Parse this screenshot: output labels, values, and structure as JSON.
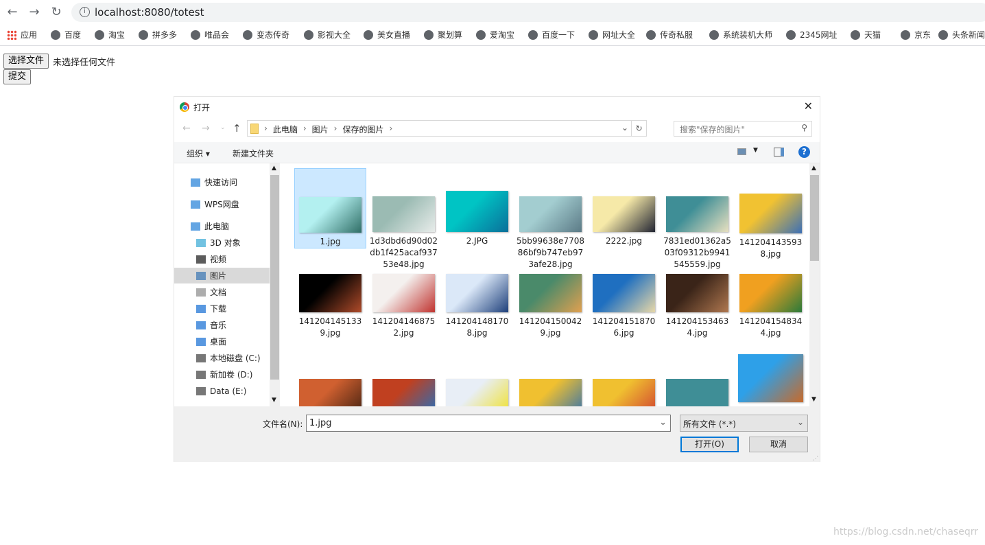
{
  "browser": {
    "url": "localhost:8080/totest",
    "bookmarks": [
      "应用",
      "百度",
      "淘宝",
      "拼多多",
      "唯品会",
      "变态传奇",
      "影视大全",
      "美女直播",
      "聚划算",
      "爱淘宝",
      "百度一下",
      "网址大全",
      "传奇私服",
      "系统装机大师",
      "2345网址",
      "天猫",
      "京东",
      "头条新闻"
    ]
  },
  "page": {
    "choose_file": "选择文件",
    "no_file": "未选择任何文件",
    "submit": "提交"
  },
  "dialog": {
    "title": "打开",
    "breadcrumb": [
      "此电脑",
      "图片",
      "保存的图片"
    ],
    "search_placeholder": "搜索\"保存的图片\"",
    "organize": "组织 ▾",
    "new_folder": "新建文件夹",
    "nav": [
      {
        "label": "快速访问",
        "icon": "star-icon"
      },
      {
        "label": "WPS网盘",
        "icon": "cloud-icon"
      },
      {
        "label": "此电脑",
        "icon": "computer-icon"
      },
      {
        "label": "3D 对象",
        "icon": "cube-icon"
      },
      {
        "label": "视频",
        "icon": "video-icon"
      },
      {
        "label": "图片",
        "icon": "picture-icon",
        "selected": true
      },
      {
        "label": "文档",
        "icon": "document-icon"
      },
      {
        "label": "下载",
        "icon": "download-icon"
      },
      {
        "label": "音乐",
        "icon": "music-icon"
      },
      {
        "label": "桌面",
        "icon": "desktop-icon"
      },
      {
        "label": "本地磁盘 (C:)",
        "icon": "drive-icon"
      },
      {
        "label": "新加卷 (D:)",
        "icon": "drive-icon"
      },
      {
        "label": "Data (E:)",
        "icon": "drive-icon"
      }
    ],
    "files": [
      {
        "name": "1.jpg",
        "colors": [
          "#b3f0f0",
          "#2f6e66"
        ],
        "selected": true
      },
      {
        "name": "1d3dbd6d90d02db1f425acaf93753e48.jpg",
        "colors": [
          "#9bbbb3",
          "#e8ecea"
        ]
      },
      {
        "name": "2.JPG",
        "colors": [
          "#00c4c4",
          "#0a6f9a"
        ]
      },
      {
        "name": "5bb99638e770886bf9b747eb973afe28.jpg",
        "colors": [
          "#a3cdd0",
          "#5b7a86"
        ]
      },
      {
        "name": "2222.jpg",
        "colors": [
          "#f6e9a8",
          "#222533"
        ]
      },
      {
        "name": "7831ed01362a503f09312b9941545559.jpg",
        "colors": [
          "#3f8e96",
          "#e8e0c0"
        ]
      },
      {
        "name": "1412041435938.jpg",
        "colors": [
          "#f1c232",
          "#3b6fb6"
        ]
      },
      {
        "name": "1412041451339.jpg",
        "colors": [
          "#000000",
          "#b04b2a"
        ]
      },
      {
        "name": "1412041468752.jpg",
        "colors": [
          "#f4f0ee",
          "#c0332f"
        ]
      },
      {
        "name": "1412041481708.jpg",
        "colors": [
          "#dbe8f8",
          "#1d3f7a"
        ]
      },
      {
        "name": "1412041500429.jpg",
        "colors": [
          "#4a8a6a",
          "#e0a050"
        ]
      },
      {
        "name": "1412041518706.jpg",
        "colors": [
          "#1f6fc0",
          "#e8d8a8"
        ]
      },
      {
        "name": "1412041534634.jpg",
        "colors": [
          "#3a2418",
          "#b07850"
        ]
      },
      {
        "name": "1412041548344.jpg",
        "colors": [
          "#f0a020",
          "#2a7a3a"
        ]
      },
      {
        "name": "",
        "colors": [
          "#d06030",
          "#402010"
        ]
      },
      {
        "name": "",
        "colors": [
          "#c04020",
          "#2070c0"
        ]
      },
      {
        "name": "",
        "colors": [
          "#e8eef6",
          "#f0e020"
        ]
      },
      {
        "name": "",
        "colors": [
          "#f0c030",
          "#3070b0"
        ]
      },
      {
        "name": "",
        "colors": [
          "#f0c030",
          "#d04030"
        ]
      },
      {
        "name": "",
        "colors": [
          "#3f8e96",
          "#3f8e96"
        ]
      },
      {
        "name": "",
        "colors": [
          "#2ea0e8",
          "#c86a2a"
        ]
      }
    ],
    "filename_label": "文件名(N):",
    "filename_value": "1.jpg",
    "filetype": "所有文件 (*.*)",
    "open": "打开(O)",
    "cancel": "取消"
  },
  "watermark": "https://blog.csdn.net/chaseqrr"
}
